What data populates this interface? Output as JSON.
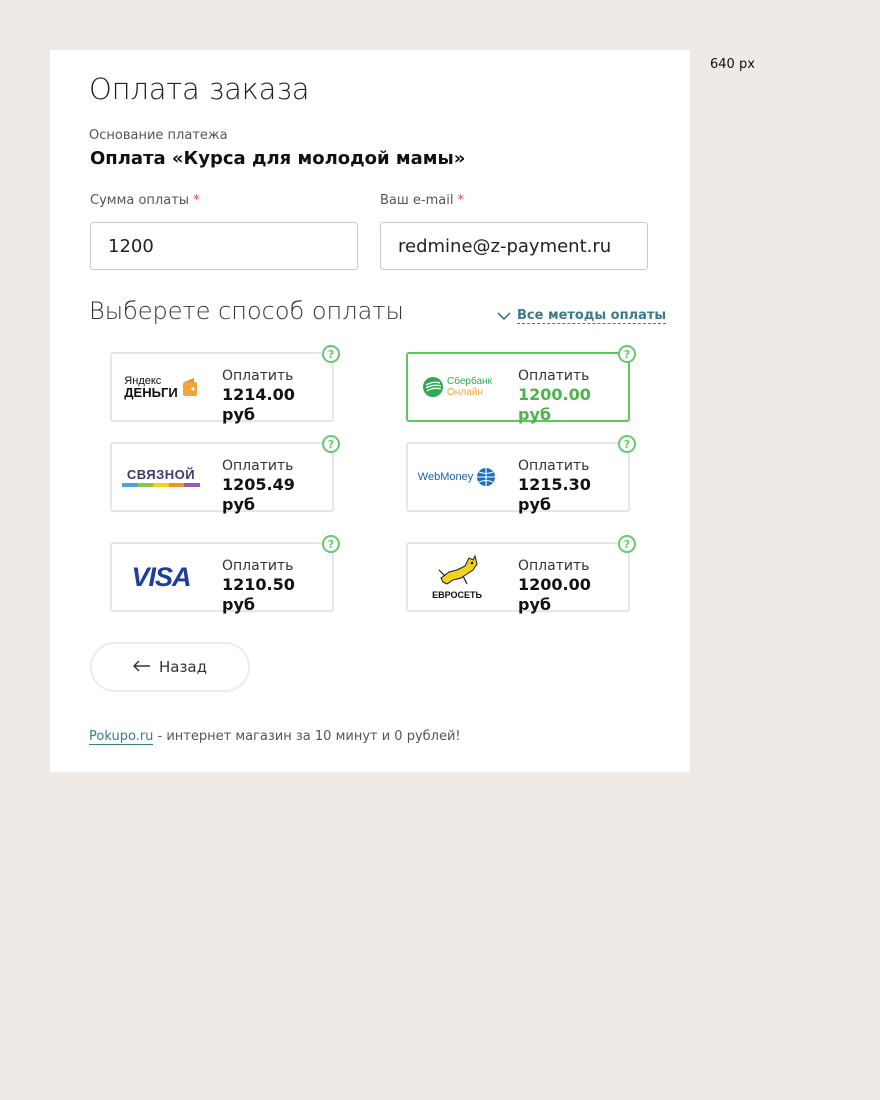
{
  "annotation": {
    "width_note": "640 px"
  },
  "form": {
    "title": "Оплата заказа",
    "basis_label": "Основание платежа",
    "basis_value": "Оплата «Курса для молодой мамы»",
    "amount_label": "Сумма оплаты",
    "amount_value": "1200",
    "email_label": "Ваш e-mail",
    "email_value": "redmine@z-payment.ru",
    "required_mark": "*"
  },
  "payment": {
    "section_title": "Выберете способ оплаты",
    "all_methods_label": "Все методы оплаты",
    "help_glyph": "?",
    "methods": [
      {
        "id": "yandex",
        "logo_top": "Яндекс",
        "logo_bottom": "Деньги",
        "label": "Оплатить",
        "price": "1214.00 руб",
        "selected": false
      },
      {
        "id": "sberbank",
        "logo_top": "Сбербанк",
        "logo_bottom": "Онлайн",
        "label": "Оплатить",
        "price": "1200.00 руб",
        "selected": true
      },
      {
        "id": "svyaznoy",
        "logo_top": "СВЯЗНОЙ",
        "label": "Оплатить",
        "price": "1205.49 руб",
        "selected": false
      },
      {
        "id": "webmoney",
        "logo_top": "WebMoney",
        "label": "Оплатить",
        "price": "1215.30 руб",
        "selected": false
      },
      {
        "id": "visa",
        "logo_top": "VISA",
        "label": "Оплатить",
        "price": "1210.50 руб",
        "selected": false
      },
      {
        "id": "euroset",
        "logo_top": "ЕВРОСЕТЬ",
        "label": "Оплатить",
        "price": "1200.00 руб",
        "selected": false
      }
    ]
  },
  "back_button": {
    "label": "Назад"
  },
  "footer": {
    "link_text": "Pokupo.ru",
    "tagline": " - интернет магазин за 10 минут и 0 рублей!"
  },
  "colors": {
    "background": "#eeebe6",
    "accent_green": "#4cb549",
    "link": "#3a7c8c",
    "required": "#e0454a"
  }
}
